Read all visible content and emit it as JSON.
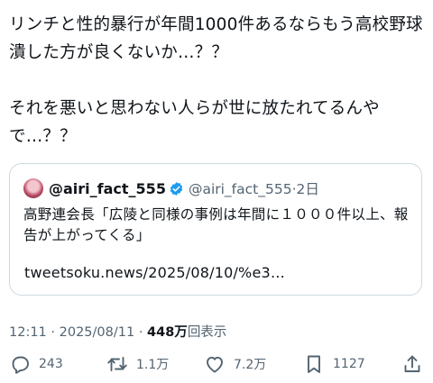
{
  "tweet": {
    "paragraph1": "リンチと性的暴行が年間1000件あるならもう高校野球潰した方が良くないか…？？",
    "paragraph2": "それを悪いと思わない人らが世に放たれてるんやで…？？"
  },
  "quote": {
    "display_name": "@airi_fact_555",
    "handle": "@airi_fact_555",
    "separator": "·",
    "age": "2日",
    "body": "高野連会長「広陵と同様の事例は年間に１０００件以上、報告が上がってくる」",
    "link": "tweetsoku.news/2025/08/10/%e3…",
    "avatar_icon": "user-avatar",
    "badge_icon": "verified-badge-icon",
    "badge_color": "#1d9bf0"
  },
  "meta": {
    "time": "12:11",
    "separator": "·",
    "date": "2025/08/11",
    "views_value": "448万",
    "views_label": "回表示"
  },
  "actions": {
    "reply_count": "243",
    "retweet_count": "1.1万",
    "like_count": "7.2万",
    "bookmark_count": "1127",
    "icons": [
      "reply-icon",
      "retweet-icon",
      "like-icon",
      "bookmark-icon",
      "share-icon"
    ]
  }
}
